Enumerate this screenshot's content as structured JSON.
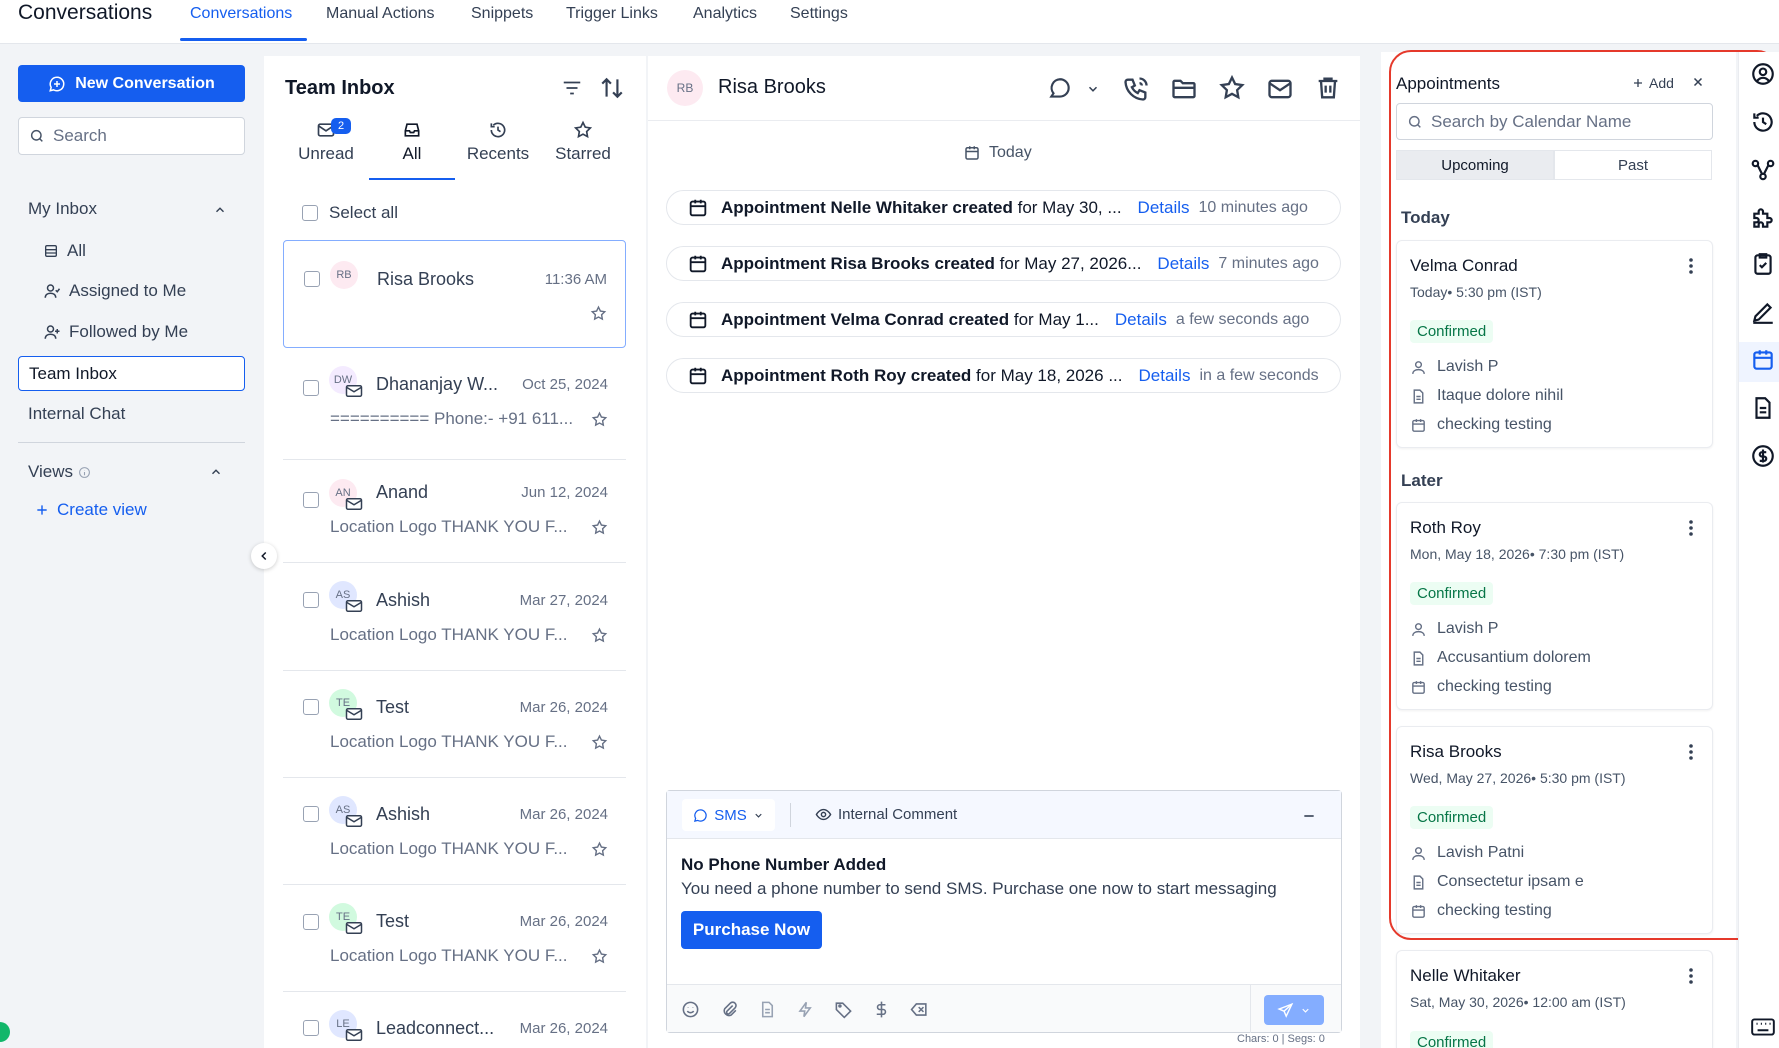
{
  "app_title": "Conversations",
  "nav": {
    "tabs": [
      "Conversations",
      "Manual Actions",
      "Snippets",
      "Trigger Links",
      "Analytics",
      "Settings"
    ],
    "active": "Conversations"
  },
  "sidebar": {
    "new_conversation": "New Conversation",
    "search_placeholder": "Search",
    "my_inbox": "My Inbox",
    "items": [
      "All",
      "Assigned to Me",
      "Followed by Me"
    ],
    "team_inbox": "Team Inbox",
    "internal_chat": "Internal Chat",
    "views": "Views",
    "create_view": "Create view"
  },
  "inbox": {
    "title": "Team Inbox",
    "tabs": [
      {
        "label": "Unread",
        "icon": "mail-icon"
      },
      {
        "label": "All",
        "icon": "inbox-icon"
      },
      {
        "label": "Recents",
        "icon": "history-icon"
      },
      {
        "label": "Starred",
        "icon": "star-icon"
      }
    ],
    "unread_count": "2",
    "select_all": "Select all",
    "conversations": [
      {
        "initials": "RB",
        "name": "Risa Brooks",
        "date": "11:36 AM",
        "snippet": "",
        "avatar_color": "#fdeaf1"
      },
      {
        "initials": "DW",
        "name": "Dhananjay W...",
        "date": "Oct 25, 2024",
        "snippet": "========== Phone:- +91 611...",
        "avatar_color": "#f4ebff"
      },
      {
        "initials": "AN",
        "name": "Anand",
        "date": "Jun 12, 2024",
        "snippet": "Location Logo THANK YOU F...",
        "avatar_color": "#fdeaf1"
      },
      {
        "initials": "AS",
        "name": "Ashish",
        "date": "Mar 27, 2024",
        "snippet": "Location Logo THANK YOU F...",
        "avatar_color": "#e0e7ff"
      },
      {
        "initials": "TE",
        "name": "Test",
        "date": "Mar 26, 2024",
        "snippet": "Location Logo THANK YOU F...",
        "avatar_color": "#d1fadf"
      },
      {
        "initials": "AS",
        "name": "Ashish",
        "date": "Mar 26, 2024",
        "snippet": "Location Logo THANK YOU F...",
        "avatar_color": "#e0e7ff"
      },
      {
        "initials": "TE",
        "name": "Test",
        "date": "Mar 26, 2024",
        "snippet": "Location Logo THANK YOU F...",
        "avatar_color": "#d1fadf"
      },
      {
        "initials": "LE",
        "name": "Leadconnect...",
        "date": "Mar 26, 2024",
        "snippet": "",
        "avatar_color": "#e0e7ff"
      }
    ]
  },
  "chat": {
    "initials": "RB",
    "contact_name": "Risa Brooks",
    "today": "Today",
    "activities": [
      {
        "bold": "Appointment Nelle Whitaker created",
        "rest": " for May 30, ...",
        "details": "Details",
        "ago": "10 minutes ago"
      },
      {
        "bold": "Appointment Risa Brooks created",
        "rest": " for May 27, 2026...",
        "details": "Details",
        "ago": "7 minutes ago"
      },
      {
        "bold": "Appointment Velma Conrad created",
        "rest": " for May 1...",
        "details": "Details",
        "ago": "a few seconds ago"
      },
      {
        "bold": "Appointment Roth Roy created",
        "rest": " for May 18, 2026 ...",
        "details": "Details",
        "ago": "in a few seconds"
      }
    ],
    "composer": {
      "channel": "SMS",
      "internal_comment": "Internal Comment",
      "warning_title": "No Phone Number Added",
      "warning_text": "You need a phone number to send SMS. Purchase one now to start messaging",
      "purchase": "Purchase Now",
      "counter": "Chars: 0 | Segs: 0"
    }
  },
  "appointments": {
    "title": "Appointments",
    "add": "Add",
    "search_placeholder": "Search by Calendar Name",
    "segments": [
      "Upcoming",
      "Past"
    ],
    "today_label": "Today",
    "later_label": "Later",
    "cards": [
      {
        "name": "Velma Conrad",
        "date": "Today• 5:30 pm (IST)",
        "status": "Confirmed",
        "user": "Lavish P",
        "title": "Itaque dolore nihil",
        "calendar": "checking testing"
      },
      {
        "name": "Roth Roy",
        "date": "Mon, May 18, 2026• 7:30 pm (IST)",
        "status": "Confirmed",
        "user": "Lavish P",
        "title": "Accusantium dolorem",
        "calendar": "checking testing"
      },
      {
        "name": "Risa Brooks",
        "date": "Wed, May 27, 2026• 5:30 pm (IST)",
        "status": "Confirmed",
        "user": "Lavish Patni",
        "title": "Consectetur ipsam e",
        "calendar": "checking testing"
      },
      {
        "name": "Nelle Whitaker",
        "date": "Sat, May 30, 2026• 12:00 am (IST)",
        "status": "Confirmed",
        "user": "",
        "title": "",
        "calendar": ""
      }
    ]
  },
  "colors": {
    "primary": "#155eef",
    "highlight": "#e5392b",
    "confirmed_text": "#067647",
    "confirmed_bg": "#ecfdf3"
  }
}
